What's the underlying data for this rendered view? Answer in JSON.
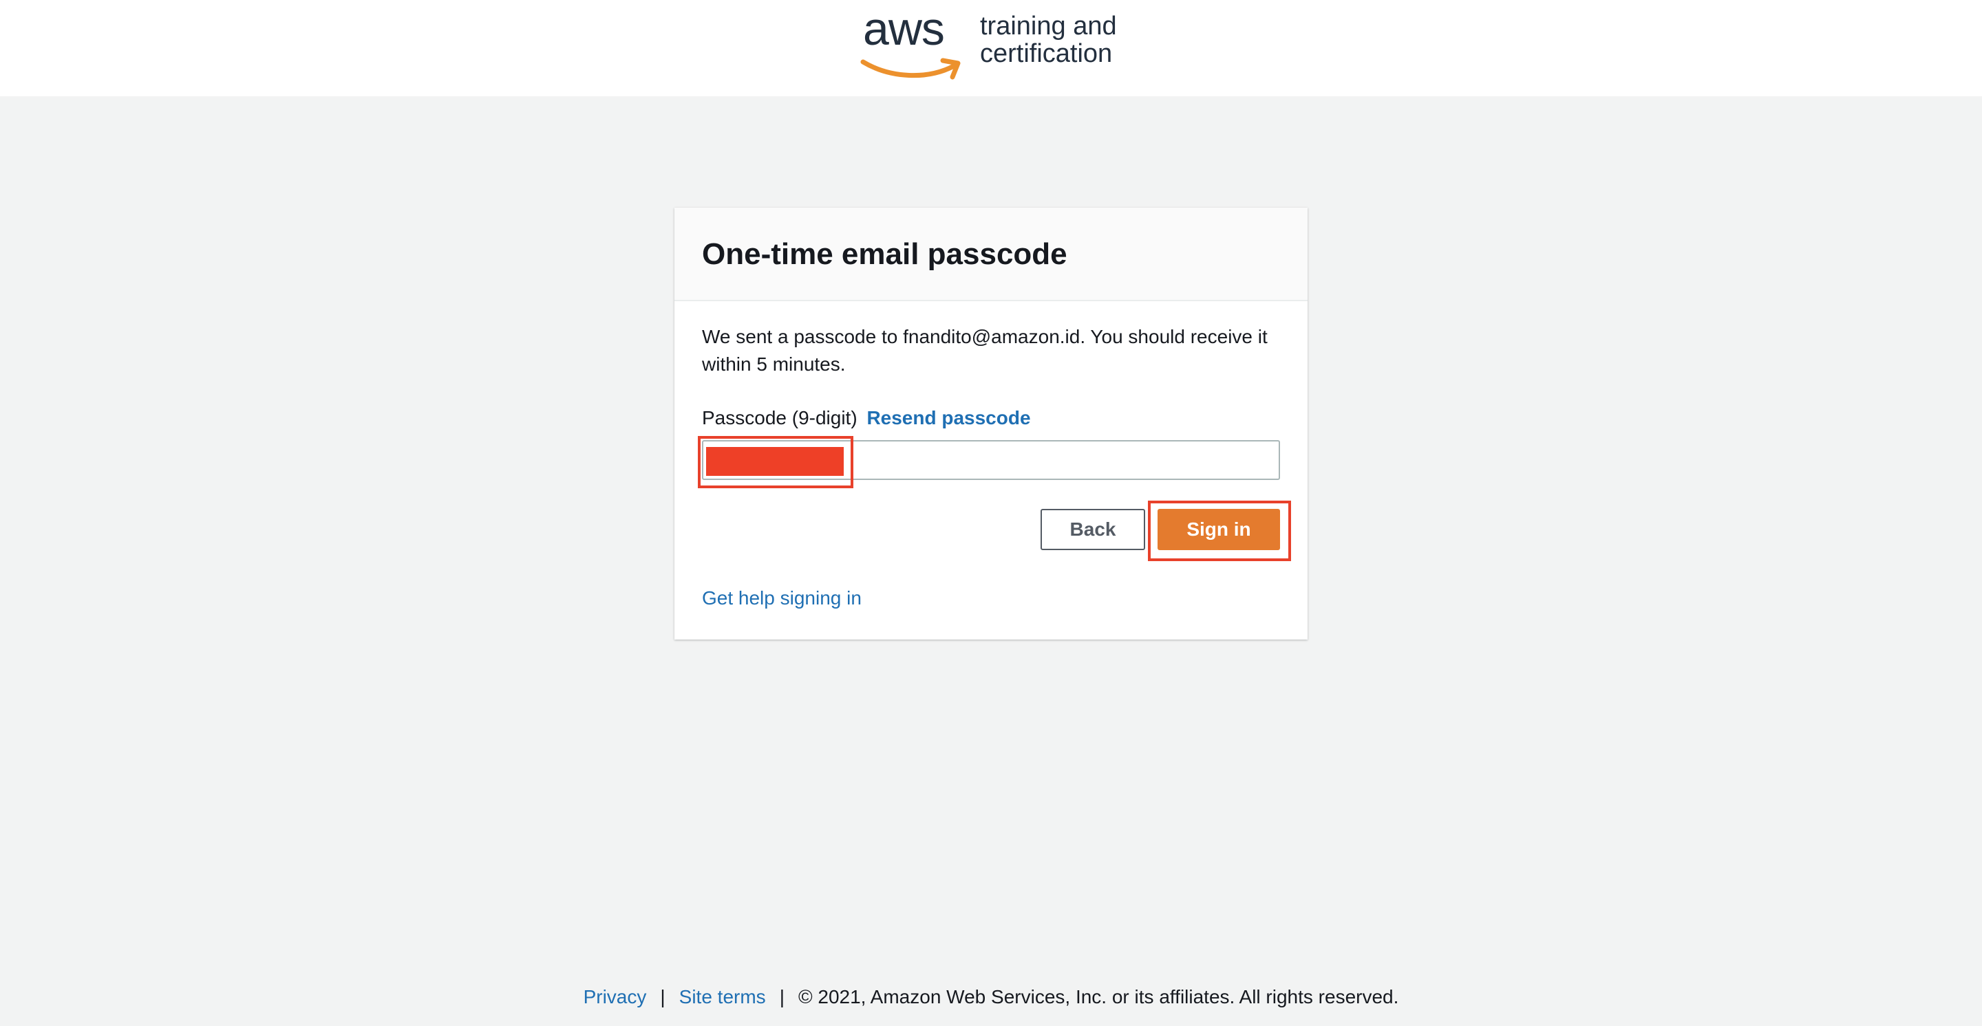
{
  "header": {
    "logo_wordmark": "aws",
    "logo_line1": "training and",
    "logo_line2": "certification"
  },
  "card": {
    "title": "One-time email passcode",
    "description": "We sent a passcode to fnandito@amazon.id. You should receive it within 5 minutes.",
    "passcode_label": "Passcode (9-digit)",
    "resend_label": "Resend passcode",
    "passcode_value": "",
    "passcode_placeholder": "",
    "back_label": "Back",
    "signin_label": "Sign in",
    "help_label": "Get help signing in"
  },
  "footer": {
    "privacy_label": "Privacy",
    "separator": "|",
    "site_terms_label": "Site terms",
    "copyright": "© 2021, Amazon Web Services, Inc. or its affiliates. All rights reserved."
  },
  "colors": {
    "brand_orange": "#e47b2e",
    "link_blue": "#1f6fb3",
    "highlight_red": "#e8412b",
    "page_background": "#f2f3f3"
  }
}
